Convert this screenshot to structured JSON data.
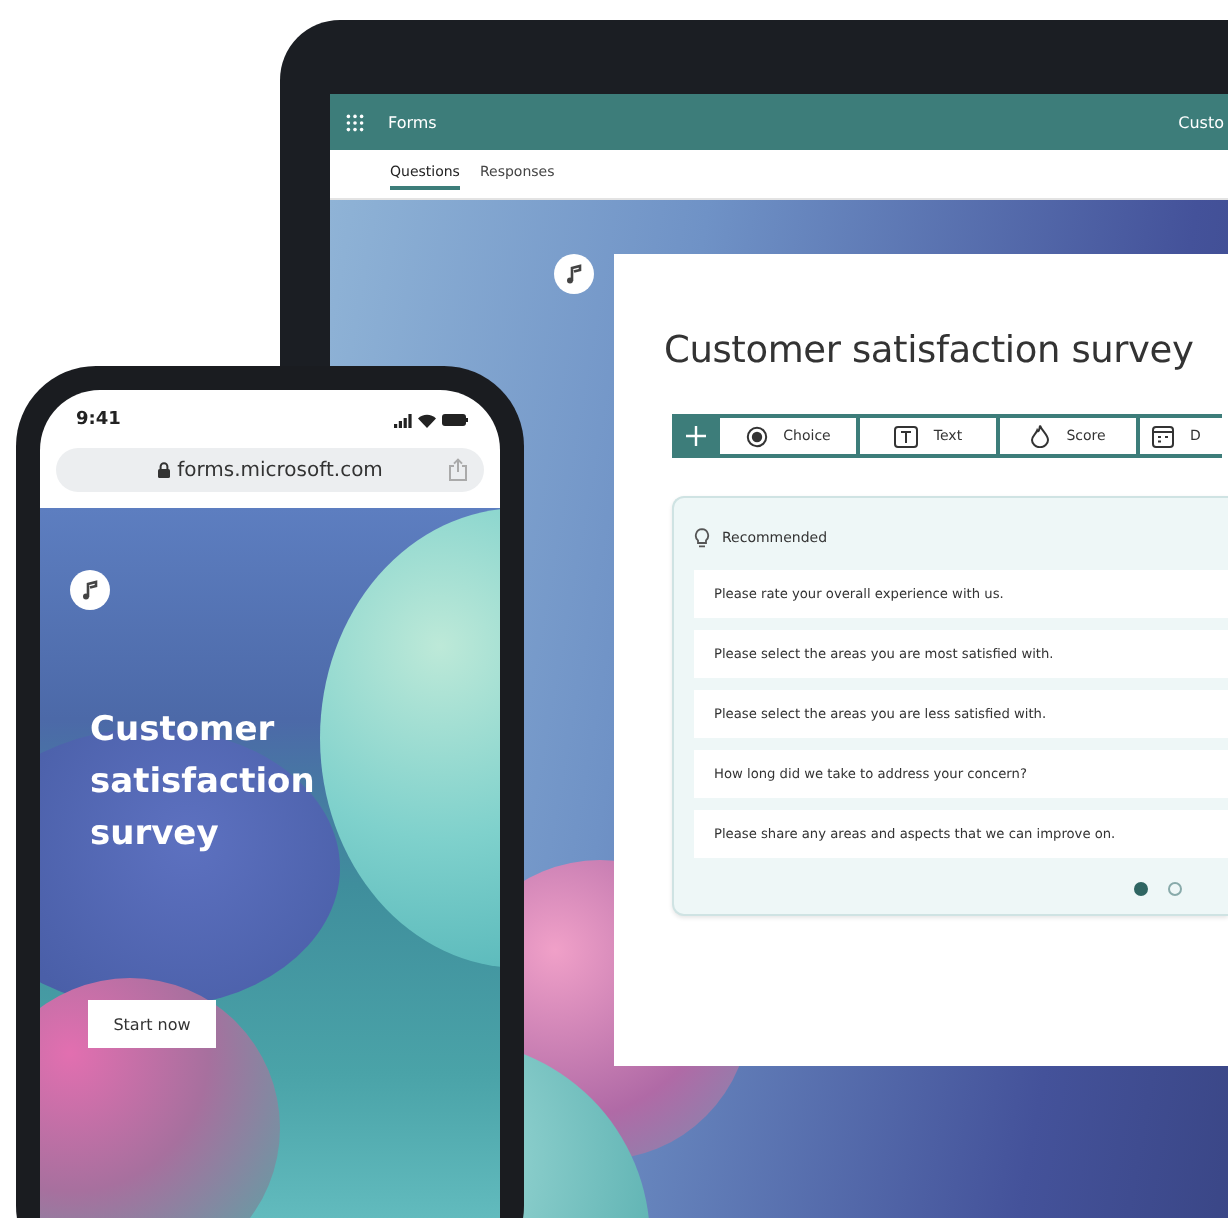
{
  "tablet": {
    "app_bar": {
      "app_name": "Forms",
      "form_name": "Custo"
    },
    "tabs": [
      {
        "label": "Questions",
        "selected": true
      },
      {
        "label": "Responses",
        "selected": false
      }
    ],
    "form": {
      "title": "Customer satisfaction survey",
      "question_types": [
        {
          "kind": "choice",
          "label": "Choice"
        },
        {
          "kind": "text",
          "label": "Text"
        },
        {
          "kind": "score",
          "label": "Score"
        },
        {
          "kind": "date",
          "label": "D"
        }
      ],
      "recommended": {
        "label": "Recommended",
        "questions": [
          "Please rate your overall experience with us.",
          "Please select the areas you are most satisfied with.",
          "Please select the areas you are less satisfied with.",
          "How long did we take to address your concern?",
          "Please share any areas and aspects that we can improve on."
        ],
        "pages": [
          {
            "selected": true
          },
          {
            "selected": false
          }
        ]
      }
    }
  },
  "phone": {
    "time": "9:41",
    "url": "forms.microsoft.com",
    "title": "Customer satisfaction survey",
    "button": "Start now"
  }
}
